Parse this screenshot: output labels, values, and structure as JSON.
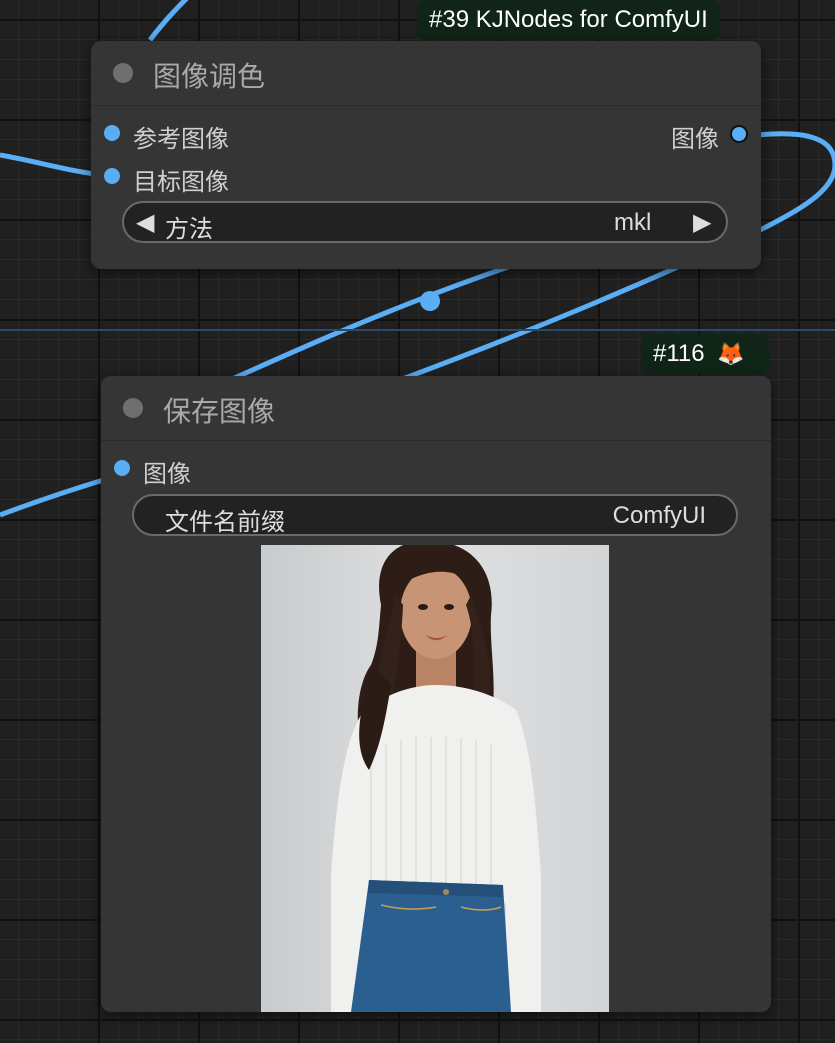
{
  "canvas": {
    "background": "#202020",
    "wire_color": "#5aaef5"
  },
  "node_color_match": {
    "badge": "#39 KJNodes for ComfyUI",
    "title": "图像调色",
    "inputs": [
      "参考图像",
      "目标图像"
    ],
    "output": "图像",
    "method_widget": {
      "label": "方法",
      "value": "mkl"
    }
  },
  "node_save_image": {
    "badge_number": "#116",
    "badge_icon": "fox-emoji-icon",
    "badge_emoji": "🦊",
    "title": "保存图像",
    "input": "图像",
    "filename_widget": {
      "label": "文件名前缀",
      "value": "ComfyUI"
    },
    "preview_image": "woman-white-sweater-blue-jeans-photo"
  }
}
